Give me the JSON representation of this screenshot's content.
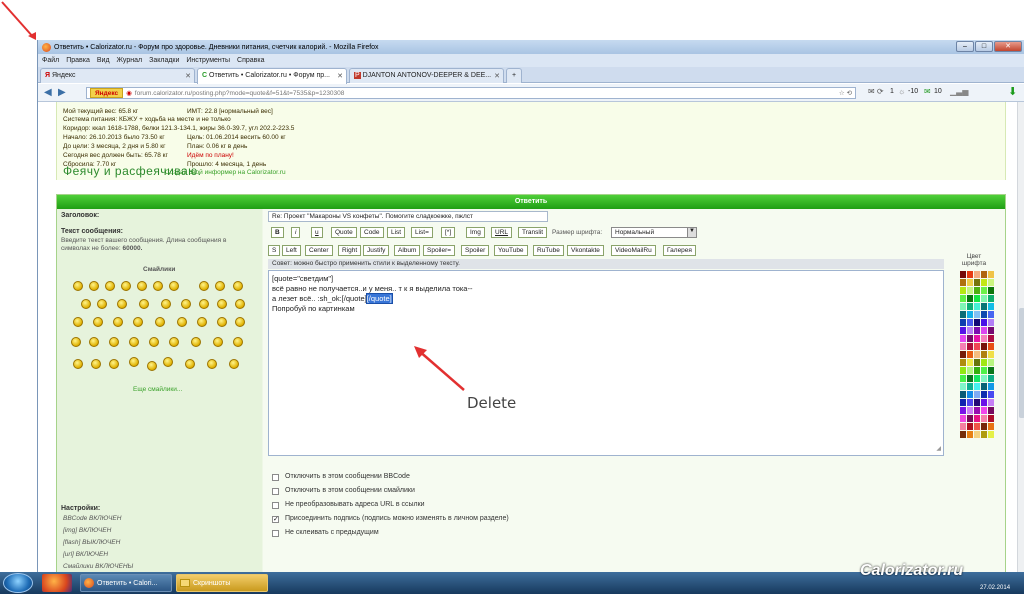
{
  "window": {
    "title": "Ответить • Calorizator.ru - Форум про здоровье. Дневники питания, счетчик калорий. - Mozilla Firefox",
    "minimize_label": "–",
    "maximize_label": "□",
    "close_label": "✕"
  },
  "menu": [
    "Файл",
    "Правка",
    "Вид",
    "Журнал",
    "Закладки",
    "Инструменты",
    "Справка"
  ],
  "tabs": [
    {
      "label": "Яндекс"
    },
    {
      "label": "Ответить • Calorizator.ru • Форум пр..."
    },
    {
      "label": "DJANTON ANTONOV-DEEPER & DEE..."
    }
  ],
  "new_tab_label": "+",
  "address": {
    "search_brand": "Яндекс",
    "url": "forum.calorizator.ru/posting.php?mode=quote&f=51&t=7535&p=1230308"
  },
  "toolbar_right": {
    "temperature": "-10",
    "count1": "1",
    "count2": "10"
  },
  "signature": {
    "lines_left": [
      "Мой текущий вес: 65.8 кг",
      "Система питания: КБЖУ + ходьба на месте и не только",
      "Коридор: ккал 1618-1788, белки 121.3-134.1, жиры 36.0-39.7, угл 202.2-223.5",
      "Начало: 26.10.2013 было 73.50 кг",
      "До цели: 3 месяца, 2 дня и 5.80 кг",
      "Сегодня вес должен быть: 65.78 кг",
      "Сбросила: 7.70 кг"
    ],
    "lines_right": [
      "ИМТ: 22.8 [нормальный вес]",
      "Цель: 01.06.2014 весить 60.00 кг",
      "План: 0.06 кг в день",
      "Идём по плану!",
      "Прошло: 4 месяца, 1 день"
    ],
    "informer_link": "Создай свой информер на Calorizator.ru",
    "motto": "Феячу и расфеячиваю."
  },
  "form": {
    "header": "Ответить",
    "subject_label": "Заголовок:",
    "subject_value": "Re: Проект \"Макароны VS конфеты\". Помогите сладкоежке, пжлст",
    "message_label": "Текст сообщения:",
    "message_hint": "Введите текст вашего сообщения. Длина сообщения в символах не более: ",
    "message_limit": "60000.",
    "smilies_title": "Смайлики",
    "more_smilies": "Еще смайлики...",
    "bb_row1": [
      "B",
      "i",
      "u",
      "Quote",
      "Code",
      "List",
      "List=",
      "[*]",
      "Img",
      "URL",
      "Translit"
    ],
    "font_size_label": "Размер шрифта:",
    "font_size_value": "Нормальный",
    "bb_row2": [
      "S",
      "Left",
      "Center",
      "Right",
      "Justify",
      "Album",
      "Spoiler=",
      "Spoiler",
      "YouTube",
      "RuTube",
      "Vkontakte",
      "VideoMailRu",
      "Галерея"
    ],
    "tip": "Совет: можно быстро применить стили к выделенному тексту.",
    "palette_title": "Цвет шрифта",
    "text_lines": [
      "[quote=\"светдим\"]",
      "всё равно не получается..и у меня.. т к я выделила тока--",
      "а лезет всё.. :sh_ok:[/quote]"
    ],
    "text_selected": "[/quote]",
    "text_last": "Попробуй по картинкам",
    "settings_label": "Настройки:",
    "settings": [
      "BBCode ВКЛЮЧЕН",
      "[img] ВКЛЮЧЕН",
      "[flash] ВЫКЛЮЧЕН",
      "[url] ВКЛЮЧЕН",
      "Смайлики ВКЛЮЧЕНЫ"
    ],
    "options": [
      {
        "label": "Отключить в этом сообщении BBCode",
        "checked": false
      },
      {
        "label": "Отключить в этом сообщении смайлики",
        "checked": false
      },
      {
        "label": "Не преобразовывать адреса URL в ссылки",
        "checked": false
      },
      {
        "label": "Присоединить подпись (подпись можно изменять в личном разделе)",
        "checked": true
      },
      {
        "label": "Не склеивать с предыдущим",
        "checked": false
      }
    ]
  },
  "annotation": {
    "label": "Delete"
  },
  "taskbar": {
    "items": [
      "Ответить • Calori...",
      "Скриншоты"
    ],
    "watermark": "Calorizator.ru",
    "date": "27.02.2014"
  }
}
